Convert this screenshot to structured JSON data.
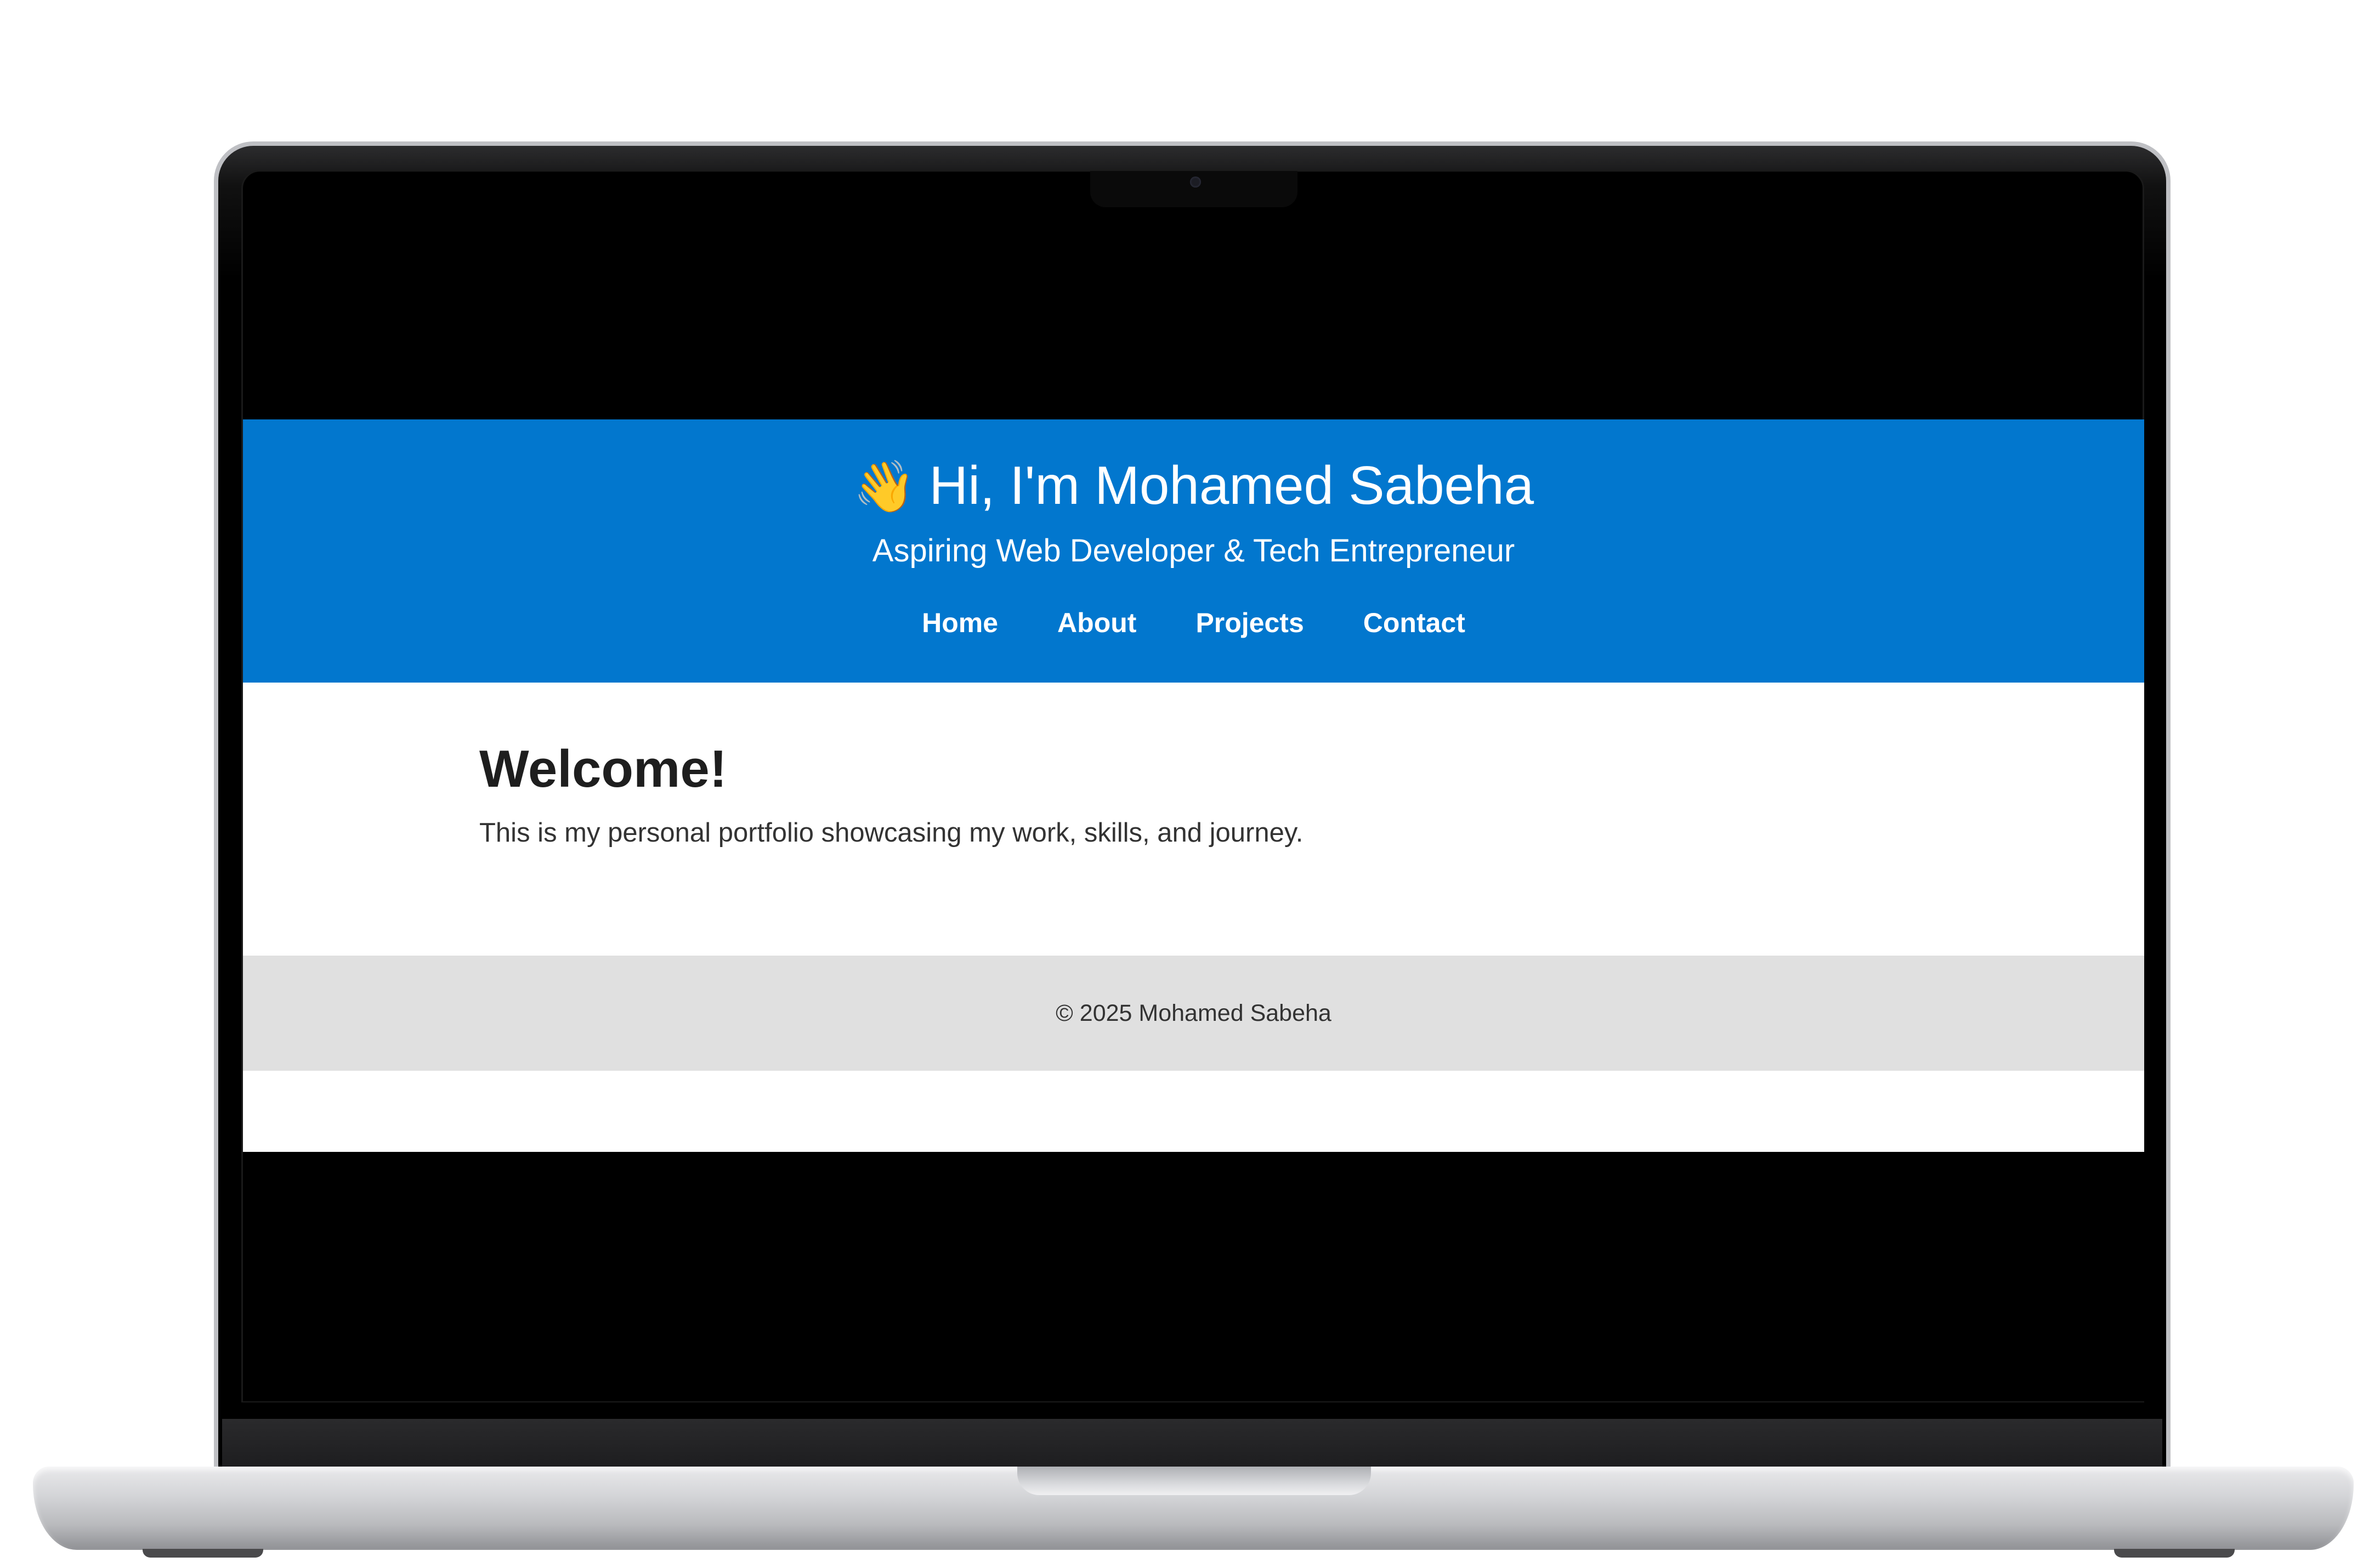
{
  "header": {
    "wave_emoji": "👋",
    "title": "Hi, I'm Mohamed Sabeha",
    "subtitle": "Aspiring Web Developer & Tech Entrepreneur"
  },
  "nav": {
    "items": [
      {
        "label": "Home"
      },
      {
        "label": "About"
      },
      {
        "label": "Projects"
      },
      {
        "label": "Contact"
      }
    ]
  },
  "main": {
    "heading": "Welcome!",
    "text": "This is my personal portfolio showcasing my work, skills, and journey."
  },
  "footer": {
    "text": "© 2025 Mohamed Sabeha"
  },
  "colors": {
    "header_bg": "#0277ce",
    "footer_bg": "#e0e0e0",
    "page_bg": "#ffffff"
  }
}
